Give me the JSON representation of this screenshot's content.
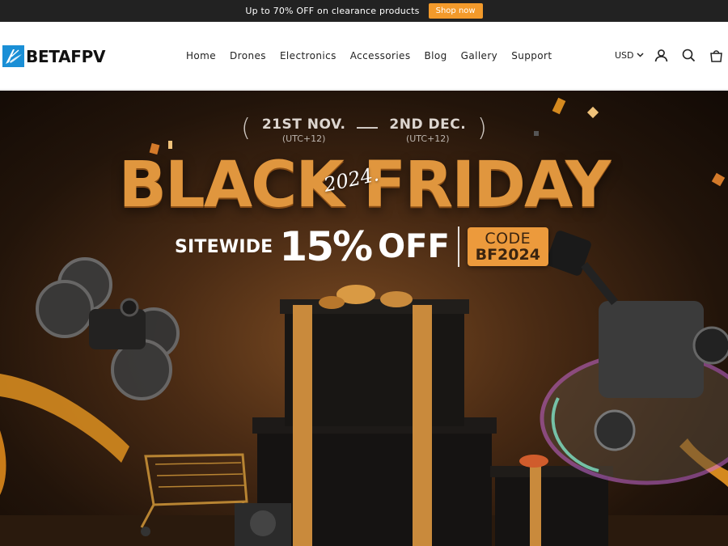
{
  "announcement": {
    "text": "Up to 70% OFF on clearance products",
    "button_label": "Shop now"
  },
  "brand": {
    "name": "BETAFPV",
    "logo_icon": "betafpv-wing-icon",
    "accent_color": "#1a8fd6"
  },
  "nav": {
    "items": [
      {
        "label": "Home"
      },
      {
        "label": "Drones"
      },
      {
        "label": "Electronics"
      },
      {
        "label": "Accessories"
      },
      {
        "label": "Blog"
      },
      {
        "label": "Gallery"
      },
      {
        "label": "Support"
      }
    ]
  },
  "header_actions": {
    "currency": "USD",
    "icons": [
      "account-icon",
      "search-icon",
      "cart-icon"
    ]
  },
  "hero": {
    "date_start": "21ST NOV.",
    "date_start_tz": "(UTC+12)",
    "date_end": "2ND DEC.",
    "date_end_tz": "(UTC+12)",
    "title": "BLACK FRIDAY",
    "year": "2024.",
    "sitewide": "SITEWIDE",
    "discount": "15%",
    "off": "OFF",
    "code_label": "CODE",
    "code_value": "BF2024",
    "ribbon_text": "BLACK FRIDAY 2024",
    "accent_color": "#e0963e"
  }
}
